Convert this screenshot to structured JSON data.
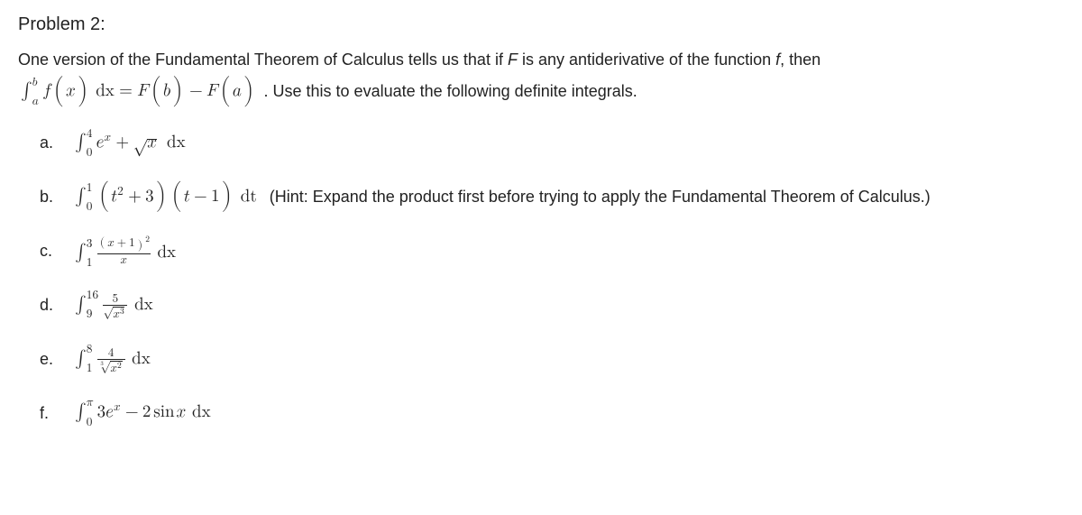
{
  "title": "Problem 2:",
  "intro_part1": "One version of the Fundamental Theorem of Calculus tells us that if ",
  "intro_F": "F",
  "intro_part2": " is any antiderivative of the function ",
  "intro_f": "f",
  "intro_part3": ", then",
  "theorem_tail": ". Use this to evaluate the following definite integrals.",
  "theorem": {
    "lower": "a",
    "upper": "b",
    "integrand": "f(x)",
    "dvar": "dx",
    "rhs_Fb": "F(b)",
    "rhs_Fa": "F(a)"
  },
  "parts": {
    "a": {
      "label": "a.",
      "lower": "0",
      "upper": "4"
    },
    "b": {
      "label": "b.",
      "lower": "0",
      "upper": "1",
      "hint": "(Hint: Expand the product first before trying to apply the Fundamental Theorem of Calculus.)"
    },
    "c": {
      "label": "c.",
      "lower": "1",
      "upper": "3"
    },
    "d": {
      "label": "d.",
      "lower": "9",
      "upper": "16"
    },
    "e": {
      "label": "e.",
      "lower": "1",
      "upper": "8"
    },
    "f": {
      "label": "f.",
      "lower": "0",
      "upper": "π"
    }
  },
  "sym": {
    "int": "∫",
    "eq": "=",
    "minus": "−",
    "plus": "+",
    "dx": "dx",
    "dt": "dt",
    "sqrt_x": "x",
    "e_pow_x": "x",
    "e_base": "e",
    "b_poly": "t",
    "b_exp2": "2",
    "b_plus3": "3",
    "b_tminus1_t": "t",
    "b_one": "1",
    "c_num_base": "x",
    "c_num_plus1": "1",
    "c_num_sq": "2",
    "c_den": "x",
    "d_num": "5",
    "d_den_base": "x",
    "d_den_exp": "3",
    "e_num": "4",
    "e_den_base": "x",
    "e_den_exp": "2",
    "e_root_index": "3",
    "f_coef": "3",
    "f_two": "2",
    "f_sin": "sin",
    "f_xv": "x"
  }
}
